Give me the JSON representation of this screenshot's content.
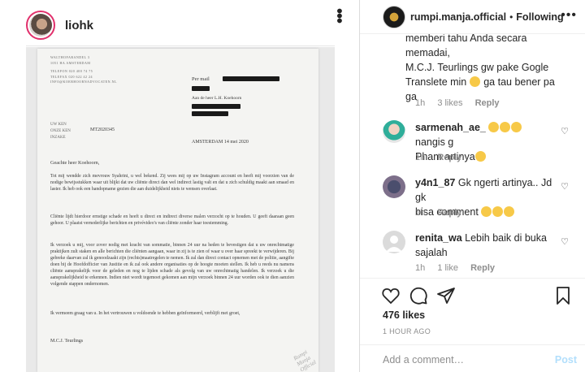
{
  "left_post": {
    "username": "liohk",
    "letter": {
      "address_lines": [
        "WALTHOFARANDEL 3",
        "1051 HA AMSTERDAM",
        "TELEFON 020 400 74 75",
        "TELEFAX 020 622 42 24",
        "INFO@KOERHOORNADVOCATEN.NL"
      ],
      "per_mail": "Per mail",
      "aan": "Aan de heer L.H. Koehoorn",
      "ref_labels": [
        "UW KEN",
        "ONZE KEN",
        "INZAKE"
      ],
      "ref_number": "MT2020345",
      "date": "AMSTERDAM     14 mei 2020",
      "salutation": "Geachte heer Koehoorn,",
      "para1": "Tot mij wendde zich mevrouw Syahrini, u wel bekend. Zij wees mij op uw Instagram account en heeft mij voorzien van de nodige bewijsstukken waar uit blijkt dat uw cliënte direct dan wel indirect lastig valt en dat u zich schuldig maakt aan smaad en laster. Ik heb ook een handopname gezien die aan duidelijkheid niets te wensen overlaat.",
      "para2": "Cliënte lijdt hierdoor ernstige schade en heeft u direct en indirect diverse malen verzocht op te houden. U geeft daaraan geen gehoor. U plaatst vernederlijke berichten en privévideo's van cliënte zonder haar toestemming.",
      "para3": "Ik verzoek u mij, voor zover nodig met kracht van sommatie, binnen 24 uur na heden te bevestigen dat u uw onrechtmatige praktijken zult staken en alle berichten die cliënten aangaan, waar in zij is te zien of waar u over haar spreekt te verwijderen. Bij gebreke daarvan zal ik genoodzaakt zijn (rechts)maatregelen te nemen. Ik zal dan direct contact opnemen met de politie, aangifte doen bij de Hoofdofficier van Justitie en ik zal ook andere organisaties op de hoogte moeten stellen. Ik heb u reeds nu namens cliënte aansprakelijk voor de geleden en nog te lijden schade als gevolg van uw onrechtmatig handelen. Ik verzoek u die aansprakelijkheid te erkennen. Indien niet wordt tegemoet gekomen aan mijn verzoek binnen 24 uur worden ook te dien aanzien volgende stappen ondernomen.",
      "para4": "Ik vermeem graag van u. In het vertrouwen u voldoende te hebben geïnformeerd, verblijft met groet,",
      "signature": "M.C.J. Teurlings",
      "watermark": "Rumpi Manja Official"
    }
  },
  "header": {
    "username": "rumpi.manja.official",
    "dot": "•",
    "follow_label": "Following"
  },
  "comments": {
    "partial": {
      "lines": [
        "memberi tahu Anda secara",
        "memadai,",
        "M.C.J. Teurlings gw pake Gogle",
        "Translete min",
        "ga tau bener pa",
        "ga"
      ],
      "time": "1h",
      "likes": "3 likes",
      "reply": "Reply"
    },
    "items": [
      {
        "user": "sarmenah_ae_",
        "text_after": "nangis g",
        "text2": "Pham artinya",
        "time": "1h",
        "likes": "",
        "reply": "Reply"
      },
      {
        "user": "y4n1_87",
        "text": "Gk ngerti artinya.. Jd gk",
        "text2": "bisa comment",
        "time": "1h",
        "likes": "",
        "reply": "Reply"
      },
      {
        "user": "renita_wa",
        "text": "Lebih baik di buka",
        "text2": "sajalah",
        "time": "1h",
        "likes": "1 like",
        "reply": "Reply"
      }
    ]
  },
  "likes_count": "476 likes",
  "timestamp": "1 HOUR AGO",
  "add_comment_placeholder": "Add a comment…",
  "post_label": "Post",
  "icons": [
    "heart-icon",
    "comment-icon",
    "share-icon",
    "bookmark-icon",
    "more-icon"
  ]
}
